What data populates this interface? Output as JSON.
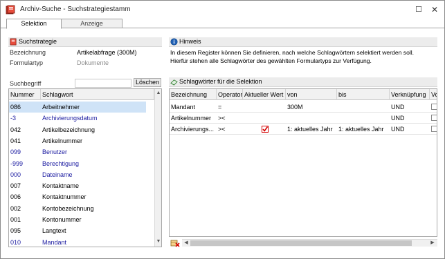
{
  "window": {
    "title": "Archiv-Suche - Suchstrategiestamm",
    "restore_glyph": "☐",
    "close_glyph": "✕"
  },
  "tabs": [
    {
      "label": "Selektion",
      "active": true
    },
    {
      "label": "Anzeige",
      "active": false
    }
  ],
  "suchstrategie": {
    "header": "Suchstrategie",
    "bezeichnung_label": "Bezeichnung",
    "bezeichnung_value": "Artikelabfrage (300M)",
    "formulartyp_label": "Formulartyp",
    "formulartyp_value": "Dokumente"
  },
  "hinweis": {
    "header": "Hinweis",
    "line1": "In diesem Register können Sie definieren, nach welche Schlagwörtern selektiert werden soll.",
    "line2": "Hierfür stehen alle Schlagwörter des gewählten Formulartyps zur Verfügung."
  },
  "search": {
    "label": "Suchbegriff",
    "value": "",
    "clear_button": "Löschen"
  },
  "keyword_list": {
    "columns": [
      "Nummer",
      "Schlagwort"
    ],
    "rows": [
      {
        "nummer": "086",
        "schlagwort": "Arbeitnehmer",
        "blue": false,
        "selected": true
      },
      {
        "nummer": "-3",
        "schlagwort": "Archivierungsdatum",
        "blue": true,
        "selected": false
      },
      {
        "nummer": "042",
        "schlagwort": "Artikelbezeichnung",
        "blue": false,
        "selected": false
      },
      {
        "nummer": "041",
        "schlagwort": "Artikelnummer",
        "blue": false,
        "selected": false
      },
      {
        "nummer": "099",
        "schlagwort": "Benutzer",
        "blue": true,
        "selected": false
      },
      {
        "nummer": "-999",
        "schlagwort": "Berechtigung",
        "blue": true,
        "selected": false
      },
      {
        "nummer": "000",
        "schlagwort": "Dateiname",
        "blue": true,
        "selected": false
      },
      {
        "nummer": "007",
        "schlagwort": "Kontaktname",
        "blue": false,
        "selected": false
      },
      {
        "nummer": "006",
        "schlagwort": "Kontaktnummer",
        "blue": false,
        "selected": false
      },
      {
        "nummer": "002",
        "schlagwort": "Kontobezeichnung",
        "blue": false,
        "selected": false
      },
      {
        "nummer": "001",
        "schlagwort": "Kontonummer",
        "blue": false,
        "selected": false
      },
      {
        "nummer": "095",
        "schlagwort": "Langtext",
        "blue": false,
        "selected": false
      },
      {
        "nummer": "010",
        "schlagwort": "Mandant",
        "blue": true,
        "selected": false
      }
    ]
  },
  "selection": {
    "header": "Schlagwörter für die Selektion",
    "columns": [
      "Bezeichnung",
      "Operator",
      "Aktueller Wert",
      "von",
      "bis",
      "Verknüpfung",
      "Vo"
    ],
    "rows": [
      {
        "bezeichnung": "Mandant",
        "operator": "=",
        "aktueller_wert": false,
        "von": "300M",
        "bis": "",
        "verknuepfung": "UND",
        "vo": false
      },
      {
        "bezeichnung": "Artikelnummer",
        "operator": "><",
        "aktueller_wert": false,
        "von": "",
        "bis": "",
        "verknuepfung": "UND",
        "vo": false
      },
      {
        "bezeichnung": "Archivierungs...",
        "operator": "><",
        "aktueller_wert": true,
        "von": "1: aktuelles Jahr",
        "bis": "1: aktuelles Jahr",
        "verknuepfung": "UND",
        "vo": false
      }
    ]
  },
  "colors": {
    "accent_blue": "#1a1aa0",
    "selected_row": "#cfe3f7",
    "check_red": "#d40000"
  },
  "icons": {
    "app": "book-icon",
    "suchstrategie": "book-icon",
    "hinweis": "info-icon",
    "selection": "eraser-icon",
    "delete_row": "delete-row-icon"
  }
}
